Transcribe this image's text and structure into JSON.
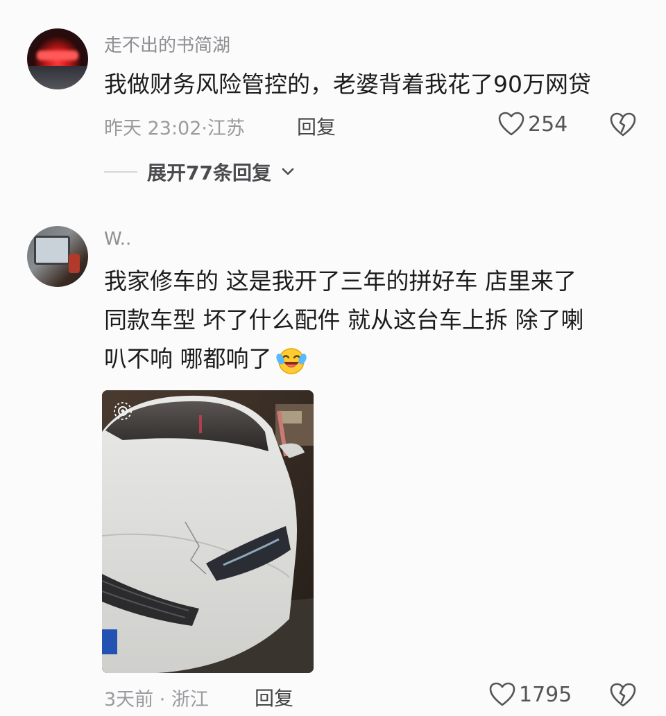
{
  "comments": [
    {
      "username": "走不出的书简湖",
      "text_lines": [
        "我做财务风险管控的，老婆背着我花了90万网贷"
      ],
      "time": "昨天 23:02",
      "location": "江苏",
      "reply_label": "回复",
      "likes": "254",
      "expand_label": "展开77条回复"
    },
    {
      "username": "W..",
      "text_lines": [
        "我家修车的 这是我开了三年的拼好车 店里来了",
        "同款车型 坏了什么配件 就从这台车上拆 除了喇",
        "叭不响 哪都响了"
      ],
      "emoji": "laughing-crying-emoji",
      "time": "3天前",
      "location": "浙江",
      "reply_label": "回复",
      "likes": "1795"
    }
  ],
  "icons": {
    "like": "heart-outline-icon",
    "dislike": "broken-heart-icon",
    "expand": "chevron-down-icon"
  },
  "colors": {
    "background": "#fbfbfb",
    "text": "#1c1c1e",
    "secondary": "#8e8e93"
  }
}
